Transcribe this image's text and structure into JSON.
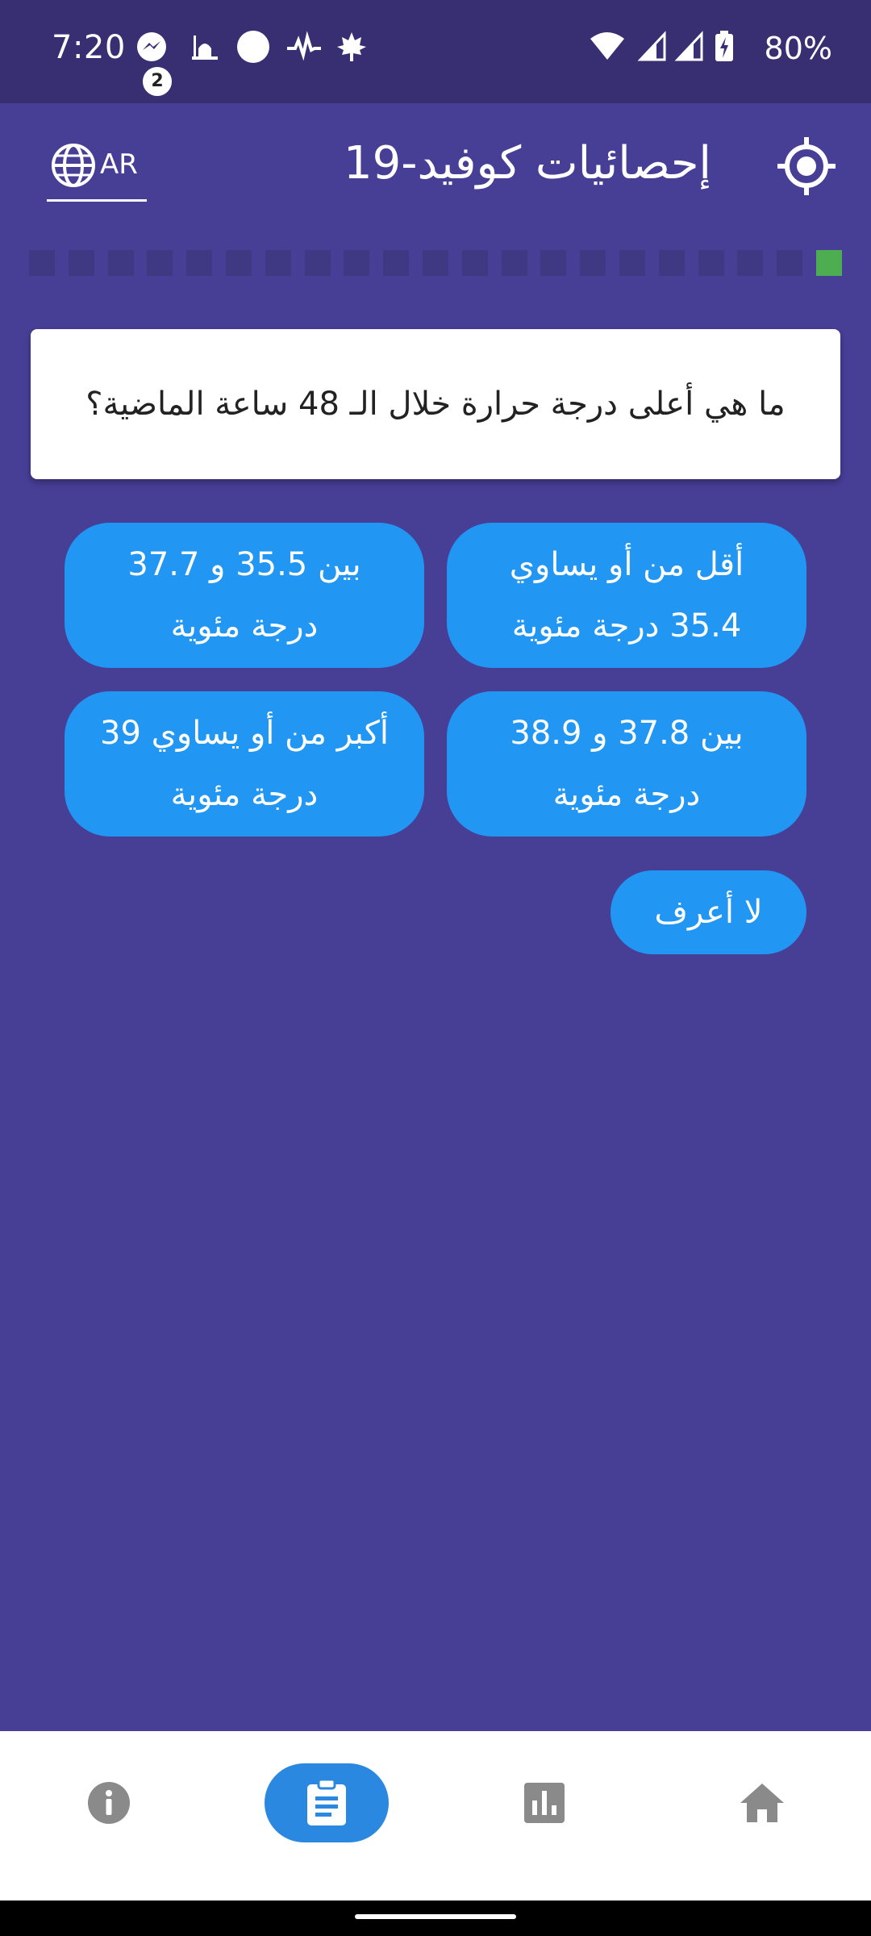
{
  "status_bar": {
    "time": "7:20",
    "notification_badge": "2",
    "battery": "80%",
    "notification_icons": [
      "messenger-icon",
      "mosque-icon",
      "circle-icon",
      "pulse-icon",
      "maple-leaf-icon"
    ],
    "system_icons": [
      "wifi-icon",
      "signal-icon",
      "signal-icon",
      "battery-charging-icon"
    ]
  },
  "app_bar": {
    "language": "AR",
    "title": "إحصائيات كوفيد-19"
  },
  "progress": {
    "total_steps": 21,
    "current_step": 1,
    "active_color": "#4cae50",
    "inactive_color": "#3f3882"
  },
  "question": {
    "text": "ما هي أعلى درجة حرارة خلال الـ 48 ساعة الماضية؟"
  },
  "answers": [
    {
      "label": "أقل من  أو يساوي 35.4 درجة مئوية"
    },
    {
      "label": "بين 35.5 و 37.7 درجة مئوية"
    },
    {
      "label": "بين 37.8 و 38.9 درجة مئوية"
    },
    {
      "label": "أكبر من أو يساوي 39 درجة مئوية"
    },
    {
      "label": "لا أعرف"
    }
  ],
  "bottom_nav": {
    "items": [
      {
        "icon": "info-icon",
        "selected": false
      },
      {
        "icon": "clipboard-icon",
        "selected": true
      },
      {
        "icon": "bar-chart-icon",
        "selected": false
      },
      {
        "icon": "home-icon",
        "selected": false
      }
    ]
  },
  "colors": {
    "background": "#473e96",
    "status_bar": "#372f72",
    "answer_button": "#2196f3",
    "nav_selected": "#2a88e0",
    "nav_icon": "#8a8a8a"
  }
}
